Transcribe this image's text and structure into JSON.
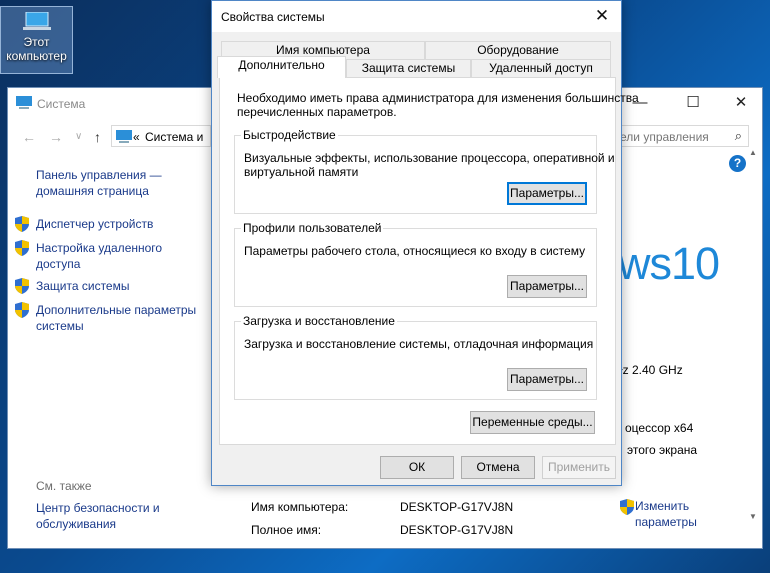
{
  "desktop": {
    "icon_label_line1": "Этот",
    "icon_label_line2": "компьютер"
  },
  "system_window": {
    "title": "Система",
    "address_prefix": "«",
    "address_text": "Система и",
    "search_placeholder": "ели управления",
    "sidebar": {
      "home_line1": "Панель управления —",
      "home_line2": "домашняя страница",
      "items": [
        {
          "label": "Диспетчер устройств"
        },
        {
          "label_line1": "Настройка удаленного",
          "label_line2": "доступа"
        },
        {
          "label": "Защита системы"
        },
        {
          "label_line1": "Дополнительные параметры",
          "label_line2": "системы"
        }
      ],
      "see_also": "См. также",
      "security_line1": "Центр безопасности и",
      "security_line2": "обслуживания"
    },
    "main": {
      "logo_text": "ws10",
      "cpu_freq": "łz  2.40 GHz",
      "arch": "оцессор x64",
      "screen": "этого экрана",
      "computer_name_label": "Имя компьютера:",
      "computer_name_value": "DESKTOP-G17VJ8N",
      "full_name_label": "Полное имя:",
      "full_name_value": "DESKTOP-G17VJ8N",
      "change_line1": "Изменить",
      "change_line2": "параметры"
    }
  },
  "dialog": {
    "title": "Свойства системы",
    "tabs_row1": [
      "Имя компьютера",
      "Оборудование"
    ],
    "tabs_row2": [
      "Дополнительно",
      "Защита системы",
      "Удаленный доступ"
    ],
    "active_tab": "Дополнительно",
    "admin_note_line1": "Необходимо иметь права администратора для изменения большинства",
    "admin_note_line2": "перечисленных параметров.",
    "performance": {
      "title": "Быстродействие",
      "desc_line1": "Визуальные эффекты, использование процессора, оперативной и",
      "desc_line2": "виртуальной памяти",
      "button": "Параметры..."
    },
    "profiles": {
      "title": "Профили пользователей",
      "desc": "Параметры рабочего стола, относящиеся ко входу в систему",
      "button": "Параметры..."
    },
    "startup": {
      "title": "Загрузка и восстановление",
      "desc": "Загрузка и восстановление системы, отладочная информация",
      "button": "Параметры..."
    },
    "env_button": "Переменные среды...",
    "ok": "ОК",
    "cancel": "Отмена",
    "apply": "Применить"
  }
}
